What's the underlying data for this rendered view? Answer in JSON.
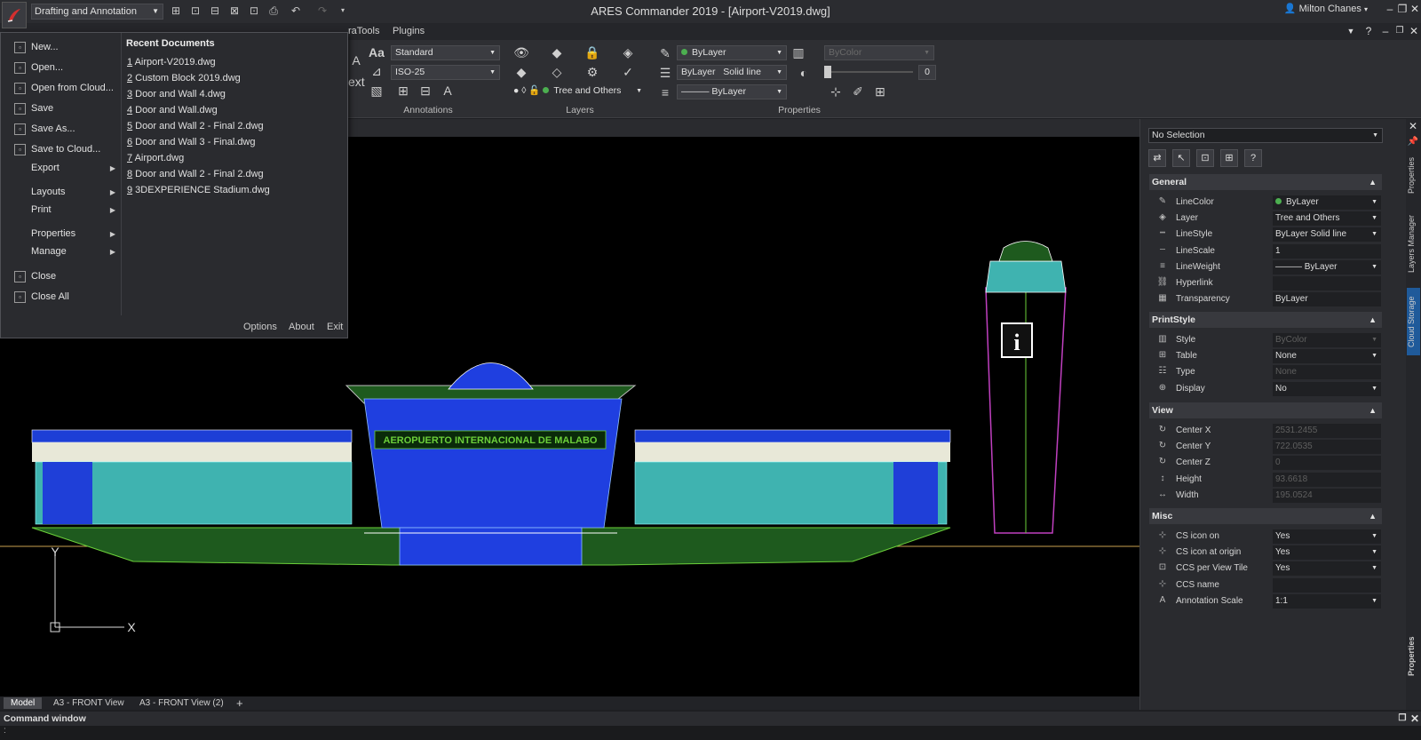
{
  "window": {
    "title": "ARES Commander 2019 - [Airport-V2019.dwg]",
    "workspace": "Drafting and Annotation",
    "user": "Milton Chanes"
  },
  "ribbon": {
    "tabs": [
      "raTools",
      "Plugins"
    ],
    "text_style": "Standard",
    "dim_style": "ISO-25",
    "layer": "Tree and Others",
    "color": "ByLayer",
    "linestyle_bylayer": "ByLayer",
    "linestyle_solid": "Solid line",
    "lineweight": "ByLayer",
    "print_style": "ByColor",
    "transparency_value": "0",
    "text_label": "ext",
    "groups": {
      "annotations": "Annotations",
      "layers": "Layers",
      "properties": "Properties"
    }
  },
  "app_menu": {
    "items": [
      {
        "label": "New...",
        "icon": "new-document-icon",
        "submenu": false
      },
      {
        "label": "Open...",
        "icon": "open-folder-icon",
        "submenu": false
      },
      {
        "label": "Open from Cloud...",
        "icon": "cloud-open-icon",
        "submenu": false
      },
      {
        "label": "Save",
        "icon": "save-icon",
        "submenu": false
      },
      {
        "label": "Save As...",
        "icon": "save-as-icon",
        "submenu": false
      },
      {
        "label": "Save to Cloud...",
        "icon": "cloud-save-icon",
        "submenu": false
      },
      {
        "label": "Export",
        "icon": "",
        "submenu": true
      },
      {
        "label": "Layouts",
        "icon": "",
        "submenu": true
      },
      {
        "label": "Print",
        "icon": "",
        "submenu": true
      },
      {
        "label": "Properties",
        "icon": "",
        "submenu": true
      },
      {
        "label": "Manage",
        "icon": "",
        "submenu": true
      },
      {
        "label": "Close",
        "icon": "close-doc-icon",
        "submenu": false
      },
      {
        "label": "Close All",
        "icon": "close-all-icon",
        "submenu": false
      }
    ],
    "recent_title": "Recent Documents",
    "recent": [
      {
        "n": "1",
        "name": " Airport-V2019.dwg"
      },
      {
        "n": "2",
        "name": " Custom Block 2019.dwg"
      },
      {
        "n": "3",
        "name": " Door and Wall 4.dwg"
      },
      {
        "n": "4",
        "name": " Door and Wall.dwg"
      },
      {
        "n": "5",
        "name": " Door and Wall 2 - Final 2.dwg"
      },
      {
        "n": "6",
        "name": " Door and Wall 3 - Final.dwg"
      },
      {
        "n": "7",
        "name": " Airport.dwg"
      },
      {
        "n": "8",
        "name": " Door and Wall 2 - Final 2.dwg"
      },
      {
        "n": "9",
        "name": " 3DEXPERIENCE Stadium.dwg"
      }
    ],
    "footer": {
      "options": "Options",
      "about": "About",
      "exit": "Exit"
    }
  },
  "drawing": {
    "sign_text": "AEROPUERTO INTERNACIONAL DE MALABO",
    "axis_y": "Y",
    "axis_x": "X",
    "info_glyph": "i"
  },
  "layout_tabs": [
    "Model",
    "A3 - FRONT View",
    "A3 - FRONT View (2)"
  ],
  "command_window": {
    "title": "Command window",
    "prompt": ":"
  },
  "properties_panel": {
    "selection": "No Selection",
    "sections": [
      {
        "title": "General",
        "rows": [
          {
            "name": "LineColor",
            "value": "ByLayer",
            "dd": true,
            "dot": true,
            "disabled": false,
            "icon": "pencil-icon"
          },
          {
            "name": "Layer",
            "value": "Tree and Others",
            "dd": true,
            "dot": false,
            "disabled": false,
            "icon": "layer-icon"
          },
          {
            "name": "LineStyle",
            "value": "ByLayer    Solid line",
            "dd": true,
            "dot": false,
            "disabled": false,
            "icon": "linestyle-icon"
          },
          {
            "name": "LineScale",
            "value": "1",
            "dd": false,
            "dot": false,
            "disabled": false,
            "icon": "linescale-icon"
          },
          {
            "name": "LineWeight",
            "value": "——— ByLayer",
            "dd": true,
            "dot": false,
            "disabled": false,
            "icon": "lineweight-icon"
          },
          {
            "name": "Hyperlink",
            "value": "",
            "dd": false,
            "dot": false,
            "disabled": false,
            "icon": "link-icon"
          },
          {
            "name": "Transparency",
            "value": "ByLayer",
            "dd": false,
            "dot": false,
            "disabled": false,
            "icon": "transparency-icon"
          }
        ]
      },
      {
        "title": "PrintStyle",
        "rows": [
          {
            "name": "Style",
            "value": "ByColor",
            "dd": true,
            "dot": false,
            "disabled": true,
            "icon": "style-icon"
          },
          {
            "name": "Table",
            "value": "None",
            "dd": true,
            "dot": false,
            "disabled": false,
            "icon": "table-icon"
          },
          {
            "name": "Type",
            "value": "None",
            "dd": false,
            "dot": false,
            "disabled": true,
            "icon": "type-icon"
          },
          {
            "name": "Display",
            "value": "No",
            "dd": true,
            "dot": false,
            "disabled": false,
            "icon": "display-icon"
          }
        ]
      },
      {
        "title": "View",
        "rows": [
          {
            "name": "Center X",
            "value": "2531.2455",
            "dd": false,
            "dot": false,
            "disabled": true,
            "icon": "center-x-icon"
          },
          {
            "name": "Center Y",
            "value": "722.0535",
            "dd": false,
            "dot": false,
            "disabled": true,
            "icon": "center-y-icon"
          },
          {
            "name": "Center Z",
            "value": "0",
            "dd": false,
            "dot": false,
            "disabled": true,
            "icon": "center-z-icon"
          },
          {
            "name": "Height",
            "value": "93.6618",
            "dd": false,
            "dot": false,
            "disabled": true,
            "icon": "height-icon"
          },
          {
            "name": "Width",
            "value": "195.0524",
            "dd": false,
            "dot": false,
            "disabled": true,
            "icon": "width-icon"
          }
        ]
      },
      {
        "title": "Misc",
        "rows": [
          {
            "name": "CS icon on",
            "value": "Yes",
            "dd": true,
            "dot": false,
            "disabled": false,
            "icon": "cs-icon-on-icon"
          },
          {
            "name": "CS icon at origin",
            "value": "Yes",
            "dd": true,
            "dot": false,
            "disabled": false,
            "icon": "cs-origin-icon"
          },
          {
            "name": "CCS per View Tile",
            "value": "Yes",
            "dd": true,
            "dot": false,
            "disabled": false,
            "icon": "ccs-tile-icon"
          },
          {
            "name": "CCS name",
            "value": "",
            "dd": false,
            "dot": false,
            "disabled": false,
            "icon": "ccs-name-icon"
          },
          {
            "name": "Annotation Scale",
            "value": "1:1",
            "dd": true,
            "dot": false,
            "disabled": false,
            "icon": "annotation-scale-icon"
          }
        ]
      }
    ],
    "rail_tabs": [
      "Properties",
      "Layers Manager",
      "Cloud Storage",
      "Properties"
    ]
  }
}
